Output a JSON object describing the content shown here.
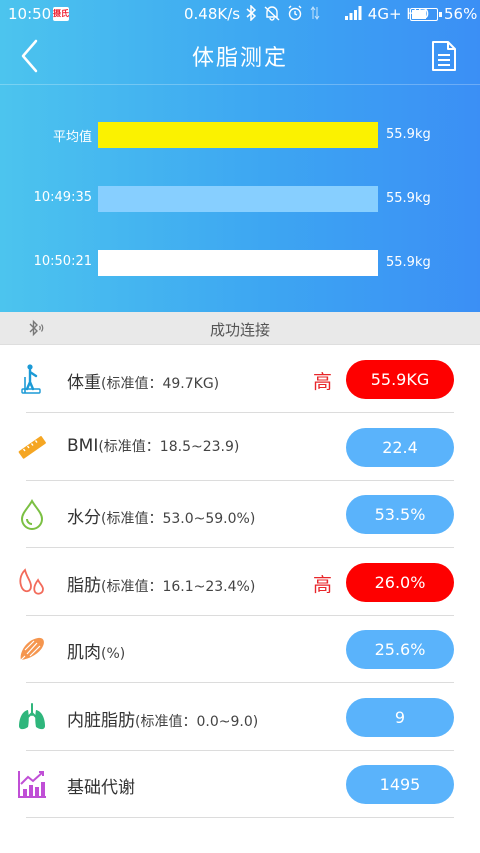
{
  "status_bar": {
    "time": "10:50",
    "app_badge": "摄氏",
    "net_speed": "0.48K/s",
    "network": "4G+ HD",
    "battery": "56%"
  },
  "title_bar": {
    "title": "体脂测定"
  },
  "chart_data": {
    "type": "bar",
    "orientation": "horizontal",
    "categories": [
      "平均值",
      "10:49:35",
      "10:50:21"
    ],
    "values": [
      55.9,
      55.9,
      55.9
    ],
    "value_labels": [
      "55.9kg",
      "55.9kg",
      "55.9kg"
    ],
    "colors": [
      "#fbf200",
      "#87cfff",
      "#ffffff"
    ]
  },
  "connection": {
    "status": "成功连接"
  },
  "metrics": [
    {
      "name": "体重",
      "standard": "(标准值：49.7KG)",
      "flag": "高",
      "value": "55.9KG",
      "pill_color": "#fe0000",
      "icon": "scale-icon"
    },
    {
      "name": "BMI",
      "standard": "(标准值：18.5~23.9)",
      "flag": "",
      "value": "22.4",
      "pill_color": "#5ab3fb",
      "icon": "ruler-icon"
    },
    {
      "name": "水分",
      "standard": "(标准值：53.0~59.0%)",
      "flag": "",
      "value": "53.5%",
      "pill_color": "#5ab3fb",
      "icon": "water-drop-icon"
    },
    {
      "name": "脂肪",
      "standard": "(标准值：16.1~23.4%)",
      "flag": "高",
      "value": "26.0%",
      "pill_color": "#fe0000",
      "icon": "fat-icon"
    },
    {
      "name": "肌肉",
      "standard": "(%)",
      "flag": "",
      "value": "25.6%",
      "pill_color": "#5ab3fb",
      "icon": "muscle-icon"
    },
    {
      "name": "内脏脂肪",
      "standard": "(标准值：0.0~9.0)",
      "flag": "",
      "value": "9",
      "pill_color": "#5ab3fb",
      "icon": "lungs-icon"
    },
    {
      "name": "基础代谢",
      "standard": "",
      "flag": "",
      "value": "1495",
      "pill_color": "#5ab3fb",
      "icon": "metabolism-chart-icon"
    }
  ]
}
